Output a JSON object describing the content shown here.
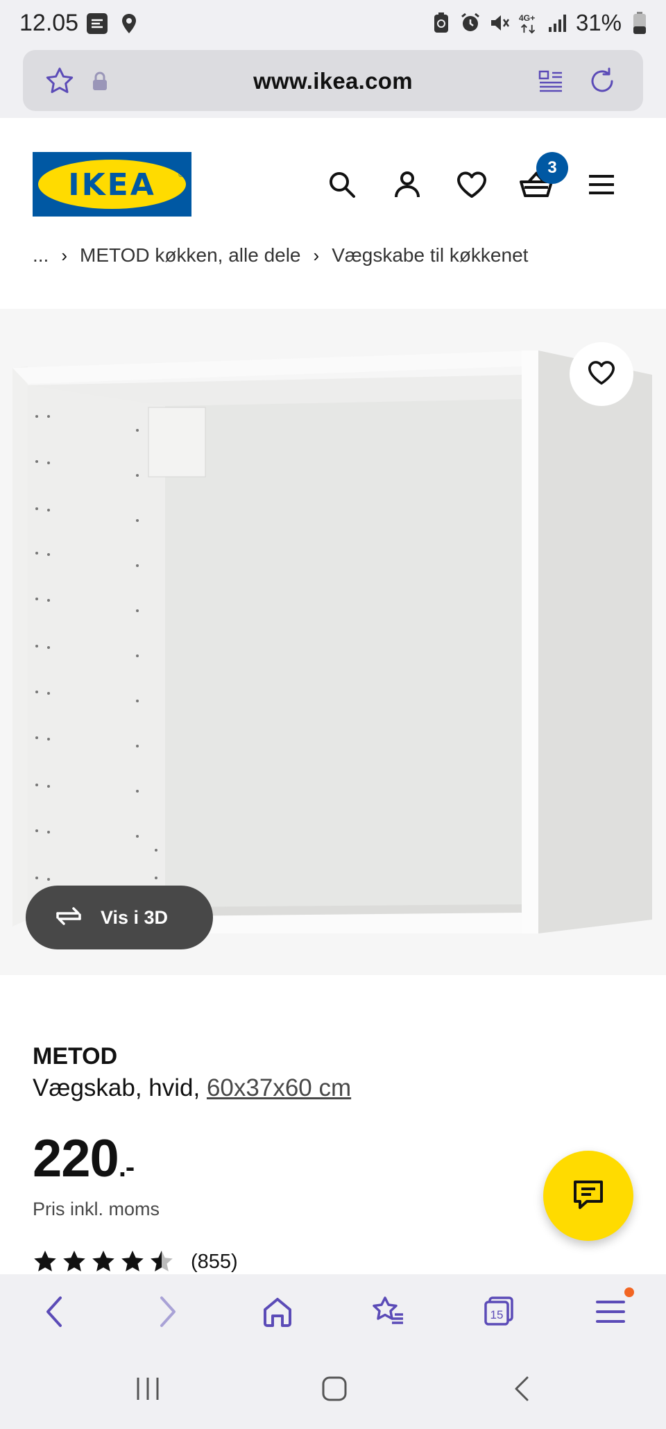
{
  "status_bar": {
    "time": "12.05",
    "battery_percent": "31%",
    "network": "4G+",
    "icons": [
      "data-saver-icon",
      "location-icon",
      "battery-saver-icon",
      "alarm-icon",
      "mute-icon",
      "network-4g-icon",
      "signal-icon",
      "battery-icon"
    ]
  },
  "browser": {
    "url": "www.ikea.com",
    "icons": [
      "bookmark-star-icon",
      "lock-icon",
      "reader-mode-icon",
      "reload-icon"
    ],
    "toolbar": {
      "icons": [
        "back-icon",
        "forward-icon",
        "home-icon",
        "bookmarks-icon",
        "tabs-icon",
        "menu-icon"
      ],
      "tabs_count": "15"
    }
  },
  "header": {
    "logo_text": "IKEA",
    "logo_registered": "®",
    "icons": [
      "search-icon",
      "account-icon",
      "wishlist-icon",
      "cart-icon",
      "hamburger-menu-icon"
    ],
    "cart_count": "3"
  },
  "breadcrumb": {
    "items": [
      "...",
      "METOD køkken, alle dele",
      "Vægskabe til køkkenet"
    ]
  },
  "product": {
    "name": "METOD",
    "description_prefix": "Vægskab, hvid, ",
    "dimensions": "60x37x60 cm",
    "price": "220",
    "price_suffix": ".-",
    "price_note": "Pris inkl. moms",
    "rating_value": 4.5,
    "rating_max": 5,
    "review_count": "(855)",
    "view_3d_label": "Vis i 3D"
  },
  "colors": {
    "ikea_blue": "#0058a3",
    "ikea_yellow": "#ffdb00",
    "browser_accent": "#5b4bb7",
    "dark_button": "#484848",
    "notification_dot": "#f26522"
  }
}
